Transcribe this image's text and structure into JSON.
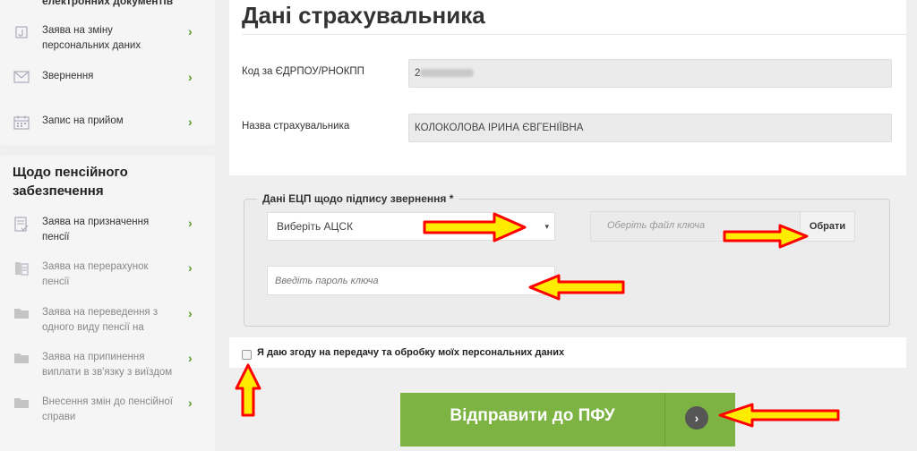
{
  "sidebar": {
    "top_cut_title": "електронних документів",
    "top_items": [
      {
        "label": "Заява на зміну персональних даних",
        "icon": "document-icon"
      },
      {
        "label": "Звернення",
        "icon": "envelope-icon"
      },
      {
        "label": "Запис на прийом",
        "icon": "calendar-icon"
      }
    ],
    "pension_title": "Щодо пенсійного забезпечення",
    "pension_items": [
      {
        "label": "Заява на призначення пенсії",
        "icon": "form-icon"
      },
      {
        "label": "Заява на перерахунок пенсії",
        "icon": "document-icon"
      },
      {
        "label": "Заява на переведення з одного виду пенсії на",
        "icon": "folder-icon"
      },
      {
        "label": "Заява на припинення виплати в зв'язку з виїздом",
        "icon": "folder-icon"
      },
      {
        "label": "Внесення змін до пенсійної справи",
        "icon": "folder-icon"
      }
    ],
    "chevron": "›"
  },
  "main": {
    "title": "Дані страхувальника",
    "code_label": "Код за ЄДРПОУ/РНОКПП",
    "code_value": "2",
    "name_label": "Назва страхувальника",
    "name_value": "КОЛОКОЛОВА ІРИНА ЄВГЕНІЇВНА"
  },
  "ecp": {
    "legend": "Дані ЕЦП щодо підпису звернення *",
    "acsk_select": "Виберіть АЦСК",
    "select_caret": "▾",
    "file_placeholder": "Оберіть файл ключа",
    "file_button": "Обрати",
    "password_placeholder": "Введіть пароль ключа"
  },
  "consent": {
    "text": "Я даю згоду на передачу та обробку моїх персональних даних",
    "checked": false
  },
  "submit": {
    "label": "Відправити до ПФУ",
    "icon": "›"
  },
  "colors": {
    "accent_green": "#7cb342",
    "chevron_green": "#5a9a2a",
    "annotation_fill": "#ffeb00",
    "annotation_stroke": "#ff0000"
  }
}
